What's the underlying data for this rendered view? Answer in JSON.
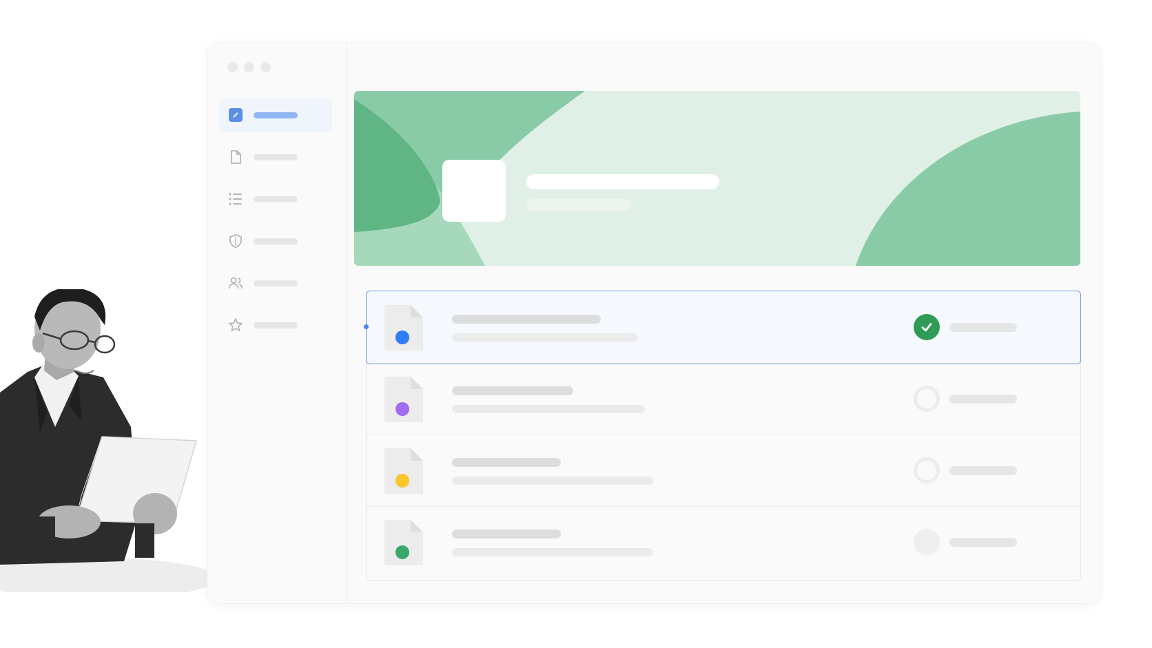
{
  "window": {
    "controls": [
      "close",
      "minimize",
      "maximize"
    ]
  },
  "sidebar": {
    "items": [
      {
        "icon": "edit-icon",
        "active": true
      },
      {
        "icon": "document-icon",
        "active": false
      },
      {
        "icon": "list-icon",
        "active": false
      },
      {
        "icon": "shield-icon",
        "active": false
      },
      {
        "icon": "users-icon",
        "active": false
      },
      {
        "icon": "star-icon",
        "active": false
      }
    ]
  },
  "banner": {
    "colors": {
      "background": "#e0f0e6",
      "accent": "#8acba7",
      "deep": "#5fb584"
    }
  },
  "documents": [
    {
      "dot_color": "#2e7cf6",
      "status": "verified",
      "status_icon": "check-icon",
      "selected": true
    },
    {
      "dot_color": "#a06cf0",
      "status": "pending",
      "selected": false
    },
    {
      "dot_color": "#f7c62b",
      "status": "pending",
      "selected": false
    },
    {
      "dot_color": "#3aa86b",
      "status": "unset",
      "selected": false
    }
  ],
  "colors": {
    "accent_blue": "#6d9be4",
    "success_green": "#2f9b57",
    "placeholder_gray": "#dddddd"
  }
}
